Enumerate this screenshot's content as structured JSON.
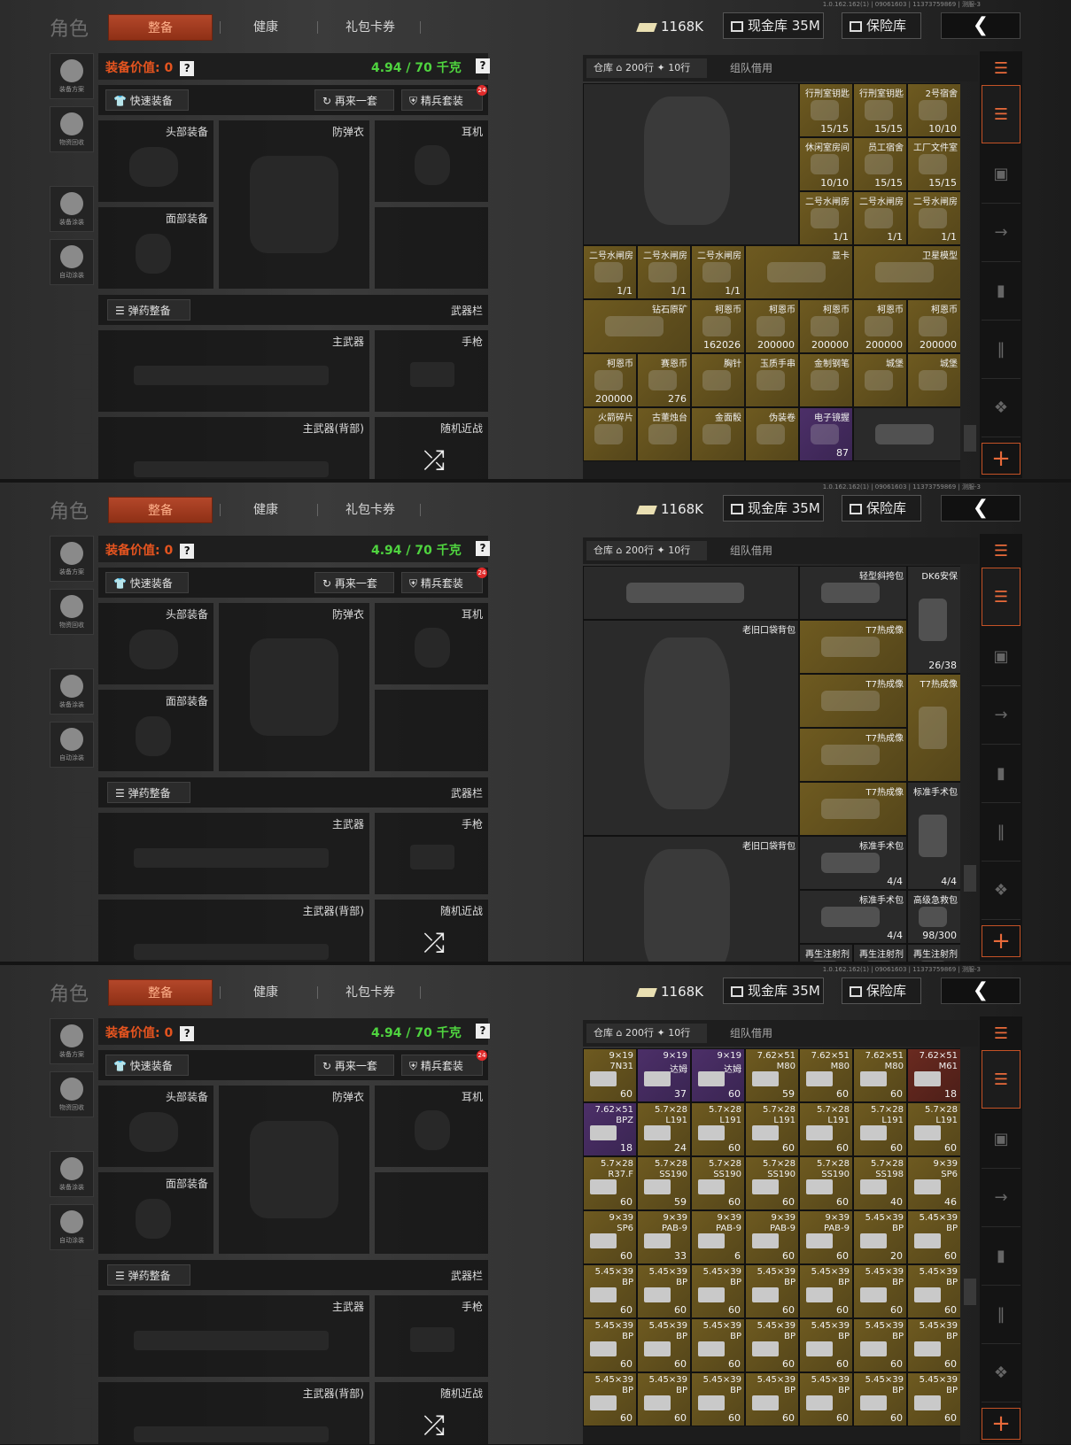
{
  "version": "1.0.162.162(1) | 09061603 | 11373759869 | 测服-3",
  "role_title": "角色",
  "tabs": [
    "整备",
    "健康",
    "礼包卡券"
  ],
  "currency": {
    "cash": "1168K",
    "gold_vault": "现金库 35M",
    "safe": "保险库"
  },
  "back_icon": "chevron-left-icon",
  "sidebar": [
    "装备方案",
    "物资回收",
    "装备涂装",
    "自动涂装"
  ],
  "equip": {
    "value_label": "装备价值: 0",
    "weight": "4.94 / 70 千克",
    "qm": "?",
    "quick": "快速装备",
    "again": "再来一套",
    "elite": "精兵套装",
    "elite_badge": "24",
    "slots": {
      "head": "头部装备",
      "armor": "防弹衣",
      "ear": "耳机",
      "face": "面部装备"
    },
    "ammo_btn": "弹药整备",
    "weapon_bar": "武器栏",
    "main": "主武器",
    "pistol": "手枪",
    "main_back": "主武器(背部)",
    "melee": "随机近战",
    "shuffle": "⤮"
  },
  "inv": {
    "warehouse": "仓库",
    "rows": "200行",
    "rows2": "10行",
    "team": "组队借用",
    "plus": "+"
  },
  "grid0": [
    {
      "n": "",
      "c": "",
      "x": 0,
      "y": 0,
      "w": 4,
      "h": 3,
      "k": "gray",
      "a": "backpack"
    },
    {
      "n": "行刑室钥匙",
      "c": "15/15",
      "x": 4,
      "y": 0,
      "w": 1,
      "h": 1,
      "k": "gold"
    },
    {
      "n": "行刑室钥匙",
      "c": "15/15",
      "x": 5,
      "y": 0,
      "w": 1,
      "h": 1,
      "k": "gold"
    },
    {
      "n": "2号宿舍",
      "c": "10/10",
      "x": 6,
      "y": 0,
      "w": 1,
      "h": 1,
      "k": "gold"
    },
    {
      "n": "休闲室房间",
      "c": "10/10",
      "x": 4,
      "y": 1,
      "w": 1,
      "h": 1,
      "k": "gold"
    },
    {
      "n": "员工宿舍",
      "c": "15/15",
      "x": 5,
      "y": 1,
      "w": 1,
      "h": 1,
      "k": "gold"
    },
    {
      "n": "工厂文件室",
      "c": "15/15",
      "x": 6,
      "y": 1,
      "w": 1,
      "h": 1,
      "k": "gold"
    },
    {
      "n": "二号水闸房",
      "c": "1/1",
      "x": 4,
      "y": 2,
      "w": 1,
      "h": 1,
      "k": "gold"
    },
    {
      "n": "二号水闸房",
      "c": "1/1",
      "x": 5,
      "y": 2,
      "w": 1,
      "h": 1,
      "k": "gold"
    },
    {
      "n": "二号水闸房",
      "c": "1/1",
      "x": 6,
      "y": 2,
      "w": 1,
      "h": 1,
      "k": "gold"
    },
    {
      "n": "二号水闸房",
      "c": "1/1",
      "x": 0,
      "y": 3,
      "w": 1,
      "h": 1,
      "k": "gold"
    },
    {
      "n": "二号水闸房",
      "c": "1/1",
      "x": 1,
      "y": 3,
      "w": 1,
      "h": 1,
      "k": "gold"
    },
    {
      "n": "二号水闸房",
      "c": "1/1",
      "x": 2,
      "y": 3,
      "w": 1,
      "h": 1,
      "k": "gold"
    },
    {
      "n": "显卡",
      "c": "",
      "x": 3,
      "y": 3,
      "w": 2,
      "h": 1,
      "k": "gold"
    },
    {
      "n": "卫星模型",
      "c": "",
      "x": 5,
      "y": 3,
      "w": 2,
      "h": 1,
      "k": "gold"
    },
    {
      "n": "钻石原矿",
      "c": "",
      "x": 0,
      "y": 4,
      "w": 2,
      "h": 1,
      "k": "gold"
    },
    {
      "n": "柯恩币",
      "c": "162026",
      "x": 2,
      "y": 4,
      "w": 1,
      "h": 1,
      "k": "gold"
    },
    {
      "n": "柯恩币",
      "c": "200000",
      "x": 3,
      "y": 4,
      "w": 1,
      "h": 1,
      "k": "gold"
    },
    {
      "n": "柯恩币",
      "c": "200000",
      "x": 4,
      "y": 4,
      "w": 1,
      "h": 1,
      "k": "gold"
    },
    {
      "n": "柯恩币",
      "c": "200000",
      "x": 5,
      "y": 4,
      "w": 1,
      "h": 1,
      "k": "gold"
    },
    {
      "n": "柯恩币",
      "c": "200000",
      "x": 6,
      "y": 4,
      "w": 1,
      "h": 1,
      "k": "gold"
    },
    {
      "n": "柯恩币",
      "c": "200000",
      "x": 0,
      "y": 5,
      "w": 1,
      "h": 1,
      "k": "gold"
    },
    {
      "n": "赛恩币",
      "c": "276",
      "x": 1,
      "y": 5,
      "w": 1,
      "h": 1,
      "k": "gold"
    },
    {
      "n": "胸针",
      "c": "",
      "x": 2,
      "y": 5,
      "w": 1,
      "h": 1,
      "k": "gold"
    },
    {
      "n": "玉质手串",
      "c": "",
      "x": 3,
      "y": 5,
      "w": 1,
      "h": 1,
      "k": "gold"
    },
    {
      "n": "金制钢笔",
      "c": "",
      "x": 4,
      "y": 5,
      "w": 1,
      "h": 1,
      "k": "gold"
    },
    {
      "n": "城堡",
      "c": "",
      "x": 5,
      "y": 5,
      "w": 1,
      "h": 1,
      "k": "gold"
    },
    {
      "n": "城堡",
      "c": "",
      "x": 6,
      "y": 5,
      "w": 1,
      "h": 1,
      "k": "gold"
    },
    {
      "n": "火箭碎片",
      "c": "",
      "x": 0,
      "y": 6,
      "w": 1,
      "h": 1,
      "k": "gold"
    },
    {
      "n": "古董烛台",
      "c": "",
      "x": 1,
      "y": 6,
      "w": 1,
      "h": 1,
      "k": "gold"
    },
    {
      "n": "金面骰",
      "c": "",
      "x": 2,
      "y": 6,
      "w": 1,
      "h": 1,
      "k": "gold"
    },
    {
      "n": "伪装卷",
      "c": "",
      "x": 3,
      "y": 6,
      "w": 1,
      "h": 1,
      "k": "gold"
    },
    {
      "n": "电子镜握",
      "c": "87",
      "x": 4,
      "y": 6,
      "w": 1,
      "h": 1,
      "k": "purple"
    },
    {
      "n": "",
      "c": "",
      "x": 5,
      "y": 6,
      "w": 2,
      "h": 1,
      "k": "gray"
    }
  ],
  "grid1": [
    {
      "n": "",
      "c": "",
      "x": 0,
      "y": 0,
      "w": 4,
      "h": 1,
      "k": "gray"
    },
    {
      "n": "轻型斜挎包",
      "c": "",
      "x": 4,
      "y": 0,
      "w": 2,
      "h": 1,
      "k": "gray"
    },
    {
      "n": "DK6安保",
      "c": "26/38",
      "x": 6,
      "y": 0,
      "w": 1,
      "h": 2,
      "k": "gray"
    },
    {
      "n": "老旧口袋背包",
      "c": "",
      "x": 0,
      "y": 1,
      "w": 4,
      "h": 4,
      "k": "gray",
      "a": "backpack"
    },
    {
      "n": "T7热成像",
      "c": "",
      "x": 4,
      "y": 1,
      "w": 2,
      "h": 1,
      "k": "gold"
    },
    {
      "n": "T7热成像",
      "c": "",
      "x": 4,
      "y": 2,
      "w": 2,
      "h": 1,
      "k": "gold"
    },
    {
      "n": "T7热成像",
      "c": "",
      "x": 6,
      "y": 2,
      "w": 1,
      "h": 2,
      "k": "gold"
    },
    {
      "n": "T7热成像",
      "c": "",
      "x": 4,
      "y": 3,
      "w": 2,
      "h": 1,
      "k": "gold"
    },
    {
      "n": "T7热成像",
      "c": "",
      "x": 4,
      "y": 4,
      "w": 2,
      "h": 1,
      "k": "gold"
    },
    {
      "n": "标准手术包",
      "c": "4/4",
      "x": 6,
      "y": 4,
      "w": 1,
      "h": 2,
      "k": "gray"
    },
    {
      "n": "老旧口袋背包",
      "c": "",
      "x": 0,
      "y": 5,
      "w": 4,
      "h": 3,
      "k": "gray",
      "a": "backpack"
    },
    {
      "n": "标准手术包",
      "c": "4/4",
      "x": 4,
      "y": 5,
      "w": 2,
      "h": 1,
      "k": "gray"
    },
    {
      "n": "标准手术包",
      "c": "4/4",
      "x": 4,
      "y": 6,
      "w": 2,
      "h": 1,
      "k": "gray"
    },
    {
      "n": "高级急救包",
      "c": "98/300",
      "x": 6,
      "y": 6,
      "w": 1,
      "h": 1,
      "k": "gray"
    },
    {
      "n": "再生注射剂",
      "c": "",
      "x": 4,
      "y": 7,
      "w": 1,
      "h": 1,
      "k": "gray"
    },
    {
      "n": "再生注射剂",
      "c": "",
      "x": 5,
      "y": 7,
      "w": 1,
      "h": 1,
      "k": "gray"
    },
    {
      "n": "再生注射剂",
      "c": "",
      "x": 6,
      "y": 7,
      "w": 1,
      "h": 1,
      "k": "gray"
    }
  ],
  "grid2": [
    [
      "9×19|7N31|60|gold",
      "9×19|达姆|37|purple",
      "9×19|达姆|60|purple",
      "7.62×51|M80|59|gold",
      "7.62×51|M80|60|gold",
      "7.62×51|M80|60|gold",
      "7.62×51|M61|18|red"
    ],
    [
      "7.62×51|BPZ|18|purple",
      "5.7×28|L191|24|gold",
      "5.7×28|L191|60|gold",
      "5.7×28|L191|60|gold",
      "5.7×28|L191|60|gold",
      "5.7×28|L191|60|gold",
      "5.7×28|L191|60|gold"
    ],
    [
      "5.7×28|R37.F|60|gold",
      "5.7×28|SS190|59|gold",
      "5.7×28|SS190|60|gold",
      "5.7×28|SS190|60|gold",
      "5.7×28|SS190|60|gold",
      "5.7×28|SS198|40|gold",
      "9×39|SP6|46|gold"
    ],
    [
      "9×39|SP6|60|gold",
      "9×39|PAB-9|33|gold",
      "9×39|PAB-9|6|gold",
      "9×39|PAB-9|60|gold",
      "9×39|PAB-9|60|gold",
      "5.45×39|BP|20|gold",
      "5.45×39|BP|60|gold"
    ],
    [
      "5.45×39|BP|60|gold",
      "5.45×39|BP|60|gold",
      "5.45×39|BP|60|gold",
      "5.45×39|BP|60|gold",
      "5.45×39|BP|60|gold",
      "5.45×39|BP|60|gold",
      "5.45×39|BP|60|gold"
    ],
    [
      "5.45×39|BP|60|gold",
      "5.45×39|BP|60|gold",
      "5.45×39|BP|60|gold",
      "5.45×39|BP|60|gold",
      "5.45×39|BP|60|gold",
      "5.45×39|BP|60|gold",
      "5.45×39|BP|60|gold"
    ],
    [
      "5.45×39|BP|60|gold",
      "5.45×39|BP|60|gold",
      "5.45×39|BP|60|gold",
      "5.45×39|BP|60|gold",
      "5.45×39|BP|60|gold",
      "5.45×39|BP|60|gold",
      "5.45×39|BP|60|gold"
    ]
  ]
}
